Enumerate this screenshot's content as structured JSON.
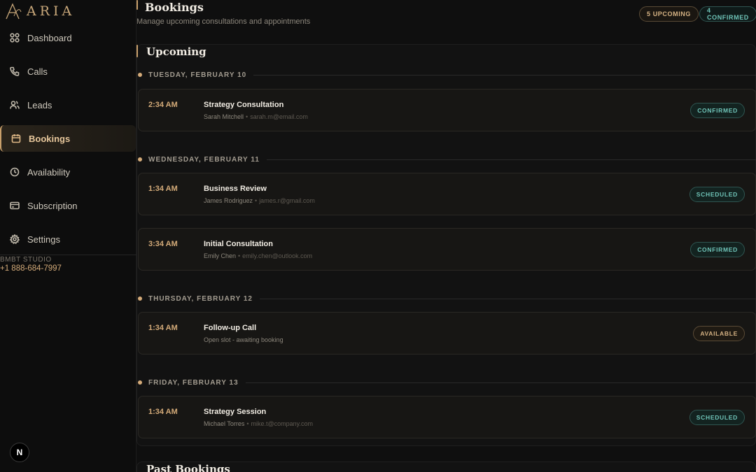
{
  "app": {
    "logo_text": "ARIA"
  },
  "sidebar": {
    "items": [
      {
        "label": "Dashboard",
        "icon": "grid-icon"
      },
      {
        "label": "Calls",
        "icon": "phone-icon"
      },
      {
        "label": "Leads",
        "icon": "users-icon"
      },
      {
        "label": "Bookings",
        "icon": "calendar-icon",
        "active": true
      },
      {
        "label": "Availability",
        "icon": "clock-icon"
      },
      {
        "label": "Subscription",
        "icon": "card-icon"
      },
      {
        "label": "Settings",
        "icon": "gear-icon"
      }
    ],
    "studio_name": "BMBT STUDIO",
    "studio_phone": "+1 888-684-7997",
    "badge": "N"
  },
  "header": {
    "title": "Bookings",
    "subtitle": "Manage upcoming consultations and appointments",
    "upcoming_pill": "5 UPCOMING",
    "confirmed_pill": "4 CONFIRMED"
  },
  "upcoming": {
    "title": "Upcoming",
    "groups": [
      {
        "date": "TUESDAY, FEBRUARY 10",
        "bookings": [
          {
            "time": "2:34 AM",
            "title": "Strategy Consultation",
            "name": "Sarah Mitchell",
            "email": "sarah.m@email.com",
            "status": "CONFIRMED"
          }
        ]
      },
      {
        "date": "WEDNESDAY, FEBRUARY 11",
        "bookings": [
          {
            "time": "1:34 AM",
            "title": "Business Review",
            "name": "James Rodriguez",
            "email": "james.r@gmail.com",
            "status": "SCHEDULED"
          },
          {
            "time": "3:34 AM",
            "title": "Initial Consultation",
            "name": "Emily Chen",
            "email": "emily.chen@outlook.com",
            "status": "CONFIRMED"
          }
        ]
      },
      {
        "date": "THURSDAY, FEBRUARY 12",
        "bookings": [
          {
            "time": "1:34 AM",
            "title": "Follow-up Call",
            "note": "Open slot - awaiting booking",
            "status": "AVAILABLE"
          }
        ]
      },
      {
        "date": "FRIDAY, FEBRUARY 13",
        "bookings": [
          {
            "time": "1:34 AM",
            "title": "Strategy Session",
            "name": "Michael Torres",
            "email": "mike.t@company.com",
            "status": "SCHEDULED"
          }
        ]
      }
    ]
  },
  "past": {
    "title": "Past Bookings"
  },
  "colors": {
    "accent": "#d4ab79",
    "teal": "#6fc4b8",
    "background": "#0f0f0f"
  }
}
